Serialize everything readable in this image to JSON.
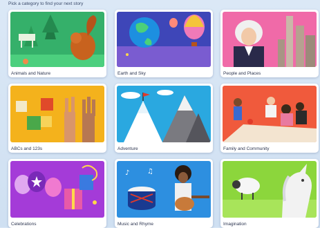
{
  "header": {
    "prompt": "Pick a category to find your next story"
  },
  "categories": [
    {
      "label": "Animals and Nature",
      "icon": "squirrel-forest-illustration-icon",
      "color": "#35b06a"
    },
    {
      "label": "Earth and Sky",
      "icon": "globe-balloon-illustration-icon",
      "color": "#3e46b8"
    },
    {
      "label": "People and Places",
      "icon": "portrait-city-illustration-icon",
      "color": "#f06aa8"
    },
    {
      "label": "ABCs and 123s",
      "icon": "blocks-fingers-illustration-icon",
      "color": "#f4b21c"
    },
    {
      "label": "Adventure",
      "icon": "mountain-flag-illustration-icon",
      "color": "#2aa8e0"
    },
    {
      "label": "Family and Community",
      "icon": "family-picnic-illustration-icon",
      "color": "#f05a3c"
    },
    {
      "label": "Celebrations",
      "icon": "balloons-gift-illustration-icon",
      "color": "#a43bd8"
    },
    {
      "label": "Music and Rhyme",
      "icon": "drum-guitar-illustration-icon",
      "color": "#2d8fe0"
    },
    {
      "label": "Imagination",
      "icon": "sheep-unicorn-illustration-icon",
      "color": "#8cd63c"
    }
  ]
}
